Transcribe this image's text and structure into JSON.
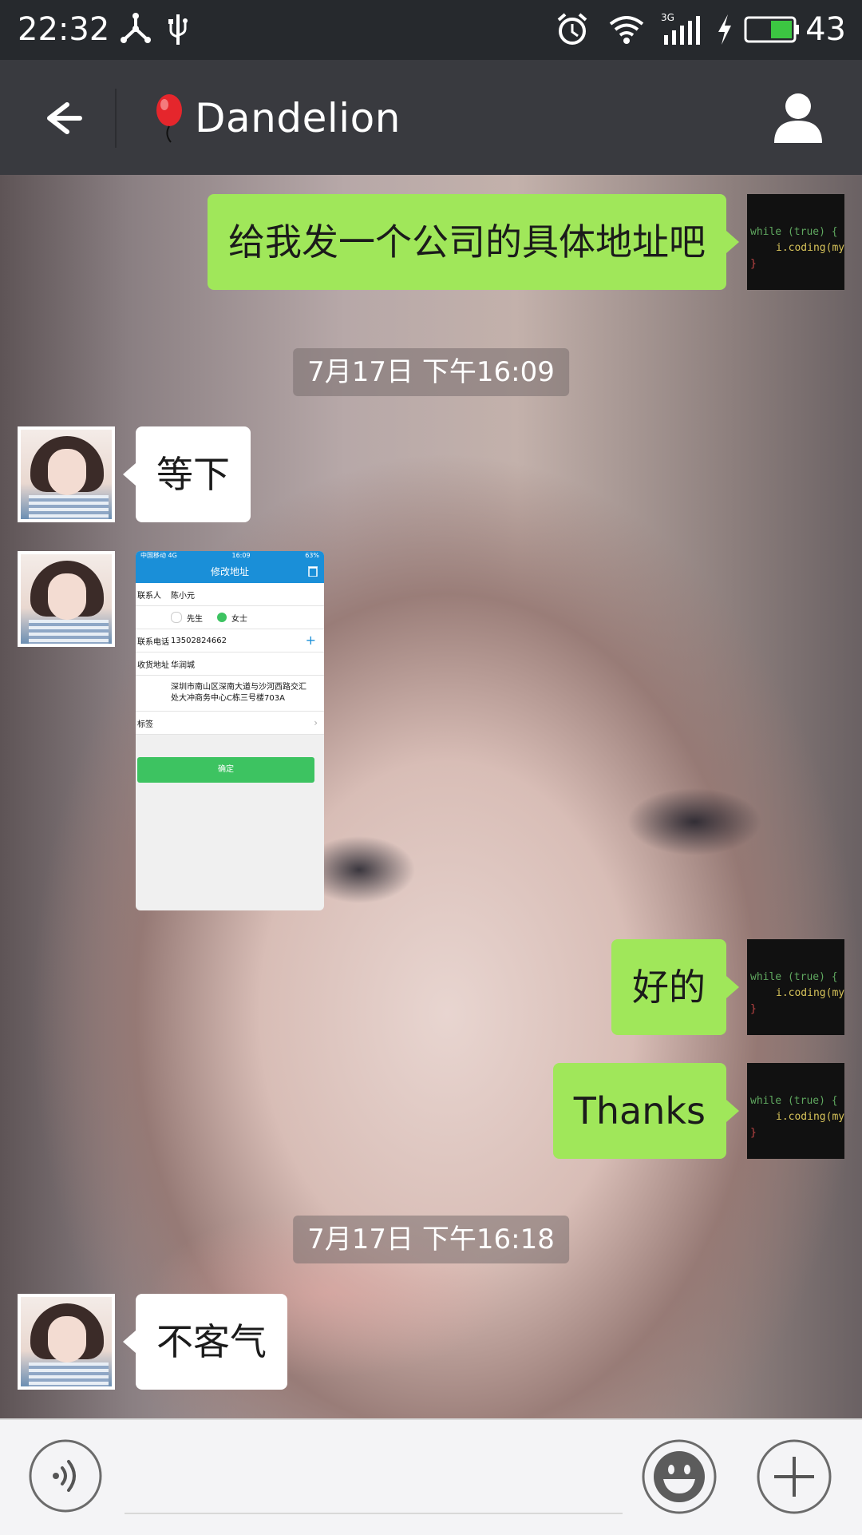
{
  "status_bar": {
    "time": "22:32",
    "battery": "43",
    "network": "3G"
  },
  "title_bar": {
    "title": "Dandelion"
  },
  "messages": {
    "m1": "给我发一个公司的具体地址吧",
    "ts1": "7月17日 下午16:09",
    "m2": "等下",
    "m4": "好的",
    "m5": "Thanks",
    "ts2": "7月17日 下午16:18",
    "m6": "不客气"
  },
  "image_message": {
    "carrier": "中国移动 4G",
    "time": "16:09",
    "battery": "63%",
    "header": "修改地址",
    "contact_label": "联系人",
    "contact_value": "陈小元",
    "option_mr": "先生",
    "option_ms": "女士",
    "phone_label": "联系电话",
    "phone_value": "13502824662",
    "address_label": "收货地址",
    "address_value": "华润城",
    "address_detail": "深圳市南山区深南大道与沙河西路交汇处大冲商务中心C栋三号楼703A",
    "tag_label": "标签",
    "confirm": "确定"
  },
  "avatar_code": {
    "line1": "while (true) {",
    "line2": "i.coding(myLife",
    "line3": "}"
  },
  "colors": {
    "sent_bubble": "#a0e75a",
    "received_bubble": "#ffffff",
    "title_bar": "#393a3f",
    "status_bar": "#26292d"
  }
}
